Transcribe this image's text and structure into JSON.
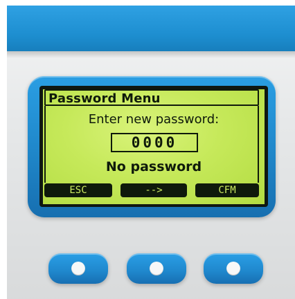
{
  "lcd": {
    "title": "Password Menu",
    "prompt": "Enter new password:",
    "password_value": "0000",
    "status": "No password",
    "softkeys": [
      "ESC",
      "-->",
      "CFM"
    ]
  },
  "colors": {
    "device_blue": "#1f86c9",
    "lcd_green": "#c6e95a",
    "lcd_ink": "#0f1a0b",
    "device_body": "#e6e8e9"
  },
  "icons": {
    "hardware_button_dot": "white-circle"
  }
}
